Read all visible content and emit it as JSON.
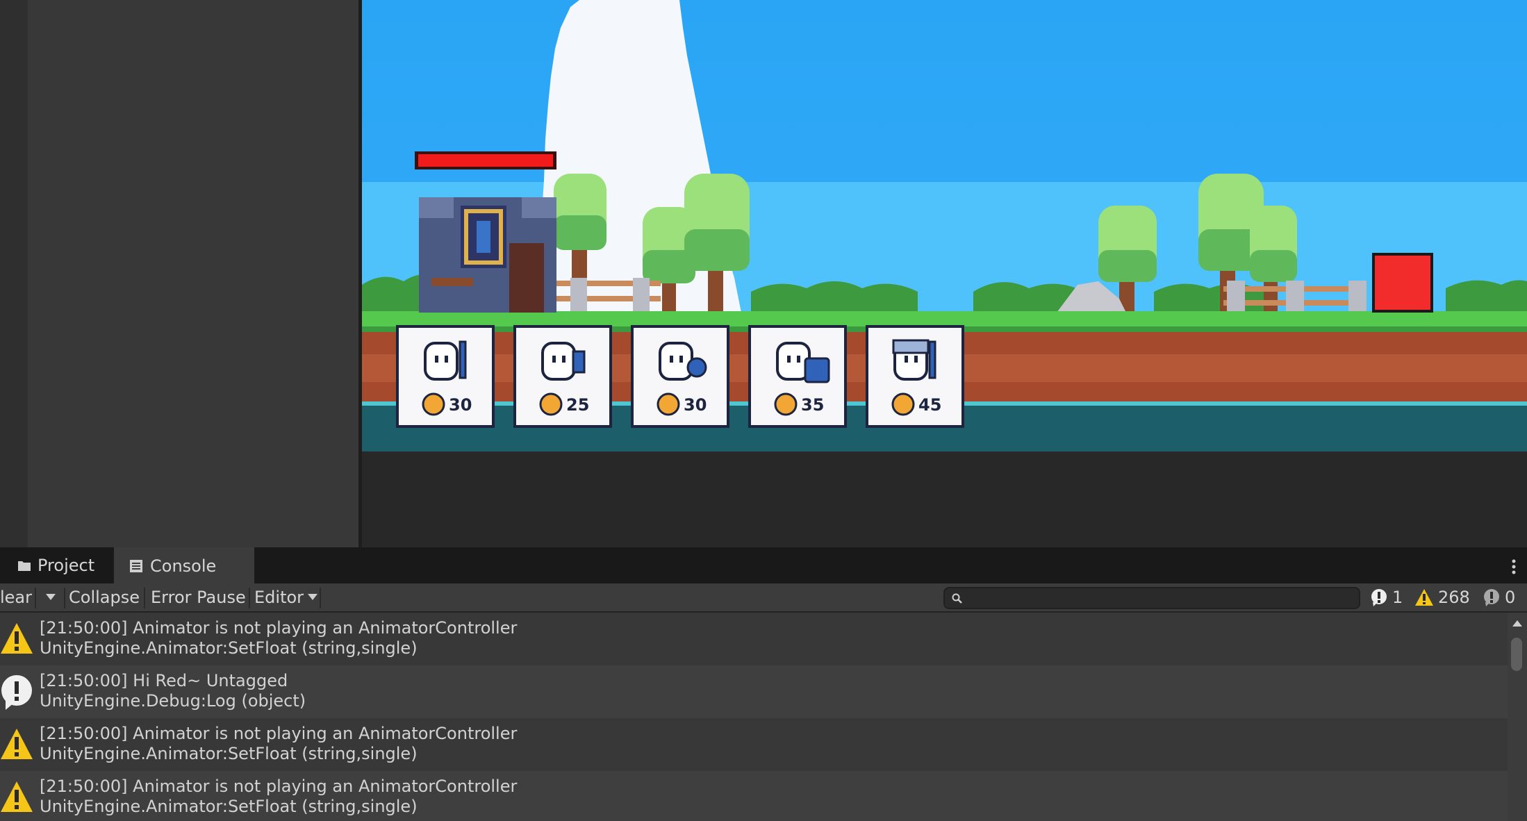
{
  "tabs": {
    "project": "Project",
    "console": "Console"
  },
  "toolbar": {
    "clear": "lear",
    "collapse": "Collapse",
    "error_pause": "Error Pause",
    "editor": "Editor",
    "search_placeholder": ""
  },
  "counters": {
    "logs": "1",
    "warnings": "268",
    "errors": "0"
  },
  "game": {
    "shop_costs": [
      "30",
      "25",
      "30",
      "35",
      "45"
    ],
    "units": [
      "knight-sword-icon",
      "archer-icon",
      "shield-bearer-icon",
      "tank-shield-icon",
      "helmet-knight-icon"
    ],
    "base_health": 1.0,
    "colors": {
      "sky": "#2ea8f6",
      "sky_lower": "#4fc1fb",
      "grass": "#55c84e",
      "dirt": "#a54a2c",
      "water": "#1d5e6b",
      "health_bar": "#f21b1b",
      "enemy": "#f22b2b"
    }
  },
  "console_logs": [
    {
      "type": "warning",
      "line1": "[21:50:00] Animator is not playing an AnimatorController",
      "line2": "UnityEngine.Animator:SetFloat (string,single)"
    },
    {
      "type": "info",
      "line1": "[21:50:00] Hi Red~ Untagged",
      "line2": "UnityEngine.Debug:Log (object)"
    },
    {
      "type": "warning",
      "line1": "[21:50:00] Animator is not playing an AnimatorController",
      "line2": "UnityEngine.Animator:SetFloat (string,single)"
    },
    {
      "type": "warning",
      "line1": "[21:50:00] Animator is not playing an AnimatorController",
      "line2": "UnityEngine.Animator:SetFloat (string,single)"
    }
  ]
}
